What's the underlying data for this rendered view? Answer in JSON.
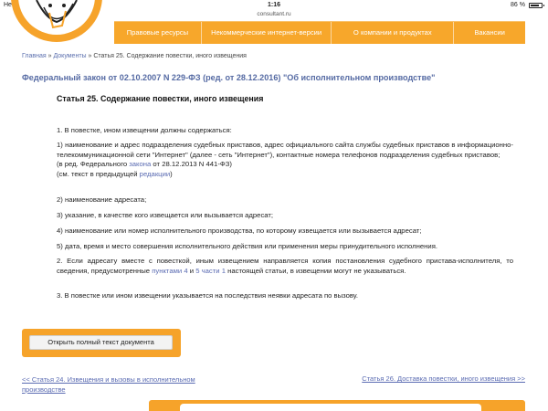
{
  "status_bar": {
    "carrier": "Нет SIM-карты",
    "time": "1:16",
    "battery_text": "86 %",
    "battery_level": 0.86
  },
  "browser": {
    "url": "consultant.ru"
  },
  "menu": {
    "items": [
      {
        "label": "Правовые ресурсы"
      },
      {
        "label": "Некоммерческие интернет-версии"
      },
      {
        "label": "О компании и продуктах"
      },
      {
        "label": "Вакансии"
      }
    ]
  },
  "breadcrumb": {
    "home": "Главная",
    "sep": "»",
    "documents": "Документы",
    "current": "Статья 25. Содержание повестки, иного извещения"
  },
  "law_title": "Федеральный закон от 02.10.2007 N 229-ФЗ (ред. от 28.12.2016) \"Об исполнительном производстве\"",
  "article_title": "Статья 25. Содержание повестки, иного извещения",
  "content": {
    "p1": "1. В повестке, ином извещении должны содержаться:",
    "item1": "1) наименование и адрес подразделения судебных приставов, адрес официального сайта службы судебных приставов в информационно-телекоммуникационной сети \"Интернет\" (далее - сеть \"Интернет\"), контактные номера телефонов подразделения судебных приставов;",
    "edition_prefix": "(в ред. Федерального ",
    "edition_link": "закона",
    "edition_suffix": " от 28.12.2013 N 441-ФЗ)",
    "see_prefix": "(см. текст в предыдущей ",
    "see_link": "редакции",
    "see_suffix": ")",
    "item2": "2) наименование адресата;",
    "item3": "3) указание, в качестве кого извещается или вызывается адресат;",
    "item4": "4) наименование или номер исполнительного производства, по которому извещается или вызывается адресат;",
    "item5": "5) дата, время и место совершения исполнительного действия или применения меры принудительного исполнения.",
    "p2_start": "2. Если адресату вместе с повесткой, иным извещением направляется копия постановления судебного пристава-исполнителя, то сведения, предусмотренные ",
    "p2_link1": "пунктами 4",
    "p2_and": " и ",
    "p2_link2": "5 части 1",
    "p2_end": " настоящей статьи, в извещении могут не указываться.",
    "p3": "3. В повестке или ином извещении указывается на последствия неявки адресата по вызову."
  },
  "open_full_button": "Открыть полный текст документа",
  "nav": {
    "prev": "<< Статья 24. Извещения и вызовы в исполнительном производстве",
    "next": "Статья 26. Доставка повестки, иного извещения >>"
  }
}
